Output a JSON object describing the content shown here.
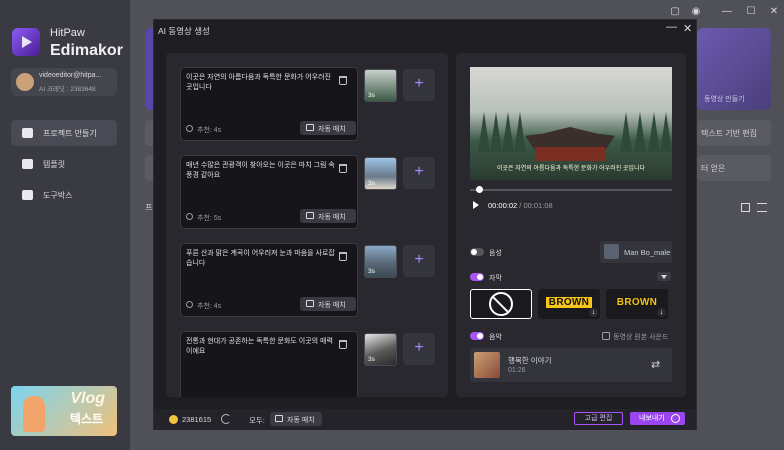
{
  "app": {
    "brand_top": "HitPaw",
    "brand_name": "Edimakor"
  },
  "user": {
    "email": "videoeditor@hitpa...",
    "credit": "AI 크레딧 : 2383648"
  },
  "nav": [
    {
      "label": "프로젝트 만들기",
      "icon": "home-icon"
    },
    {
      "label": "템플릿",
      "icon": "template-icon"
    },
    {
      "label": "도구박스",
      "icon": "toolbox-icon"
    }
  ],
  "promo": {
    "line1": "Vlog",
    "line2": "텍스트"
  },
  "background": {
    "card_label": "동영상 만들기",
    "row1": "텍스트 기반 편집",
    "row2": "터 얻은",
    "left_label": "프"
  },
  "modal": {
    "title": "AI 동영상 생성",
    "min": "—",
    "close": "✕"
  },
  "scenes": [
    {
      "text": "이곳은 자연의 아름다움과 독특한 문화가 어우러진 곳입니다",
      "duration": "추천: 4s",
      "thumb_label": "3s",
      "thumb": "forest-thumb"
    },
    {
      "text": "매년 수많은 관광객이 찾아오는 이곳은 마치 그림 속 풍경 같아요",
      "duration": "추천: 5s",
      "thumb_label": "3s",
      "thumb": "city-thumb"
    },
    {
      "text": "푸른 산과 맑은 계곡이 어우러져 눈과 마음을 사로잡습니다",
      "duration": "추천: 4s",
      "thumb_label": "3s",
      "thumb": "mountain-thumb"
    },
    {
      "text": "전통과 현대가 공존하는 독특한 문화도 이곳의 매력이에요",
      "duration": "",
      "thumb_label": "3s",
      "thumb": "building-thumb"
    }
  ],
  "auto_match": "자동 매치",
  "preview": {
    "subtitle": "이곳은 자연의 아름다움과 독특한 문화가 어우러진 곳입니다",
    "time_current": "00:00:02",
    "time_total": "/ 00:01:08",
    "progress": 0.03
  },
  "voice": {
    "label": "음성",
    "name": "Man Bo_male",
    "enabled": false
  },
  "caption": {
    "label": "자막",
    "enabled": true,
    "style_text": "BROWN"
  },
  "music": {
    "label": "음악",
    "enabled": true,
    "keep_original": "동영상 원본 사운드",
    "title": "행복한 이야기",
    "duration": "01:26"
  },
  "footer": {
    "coins": "2381615",
    "all_label": "모두:",
    "auto_match": "자동 매치",
    "advanced": "고급 편집",
    "export": "내보내기"
  },
  "colors": {
    "accent": "#a855f7",
    "export": "#9b45f0",
    "caption_yellow": "#f5c518"
  }
}
